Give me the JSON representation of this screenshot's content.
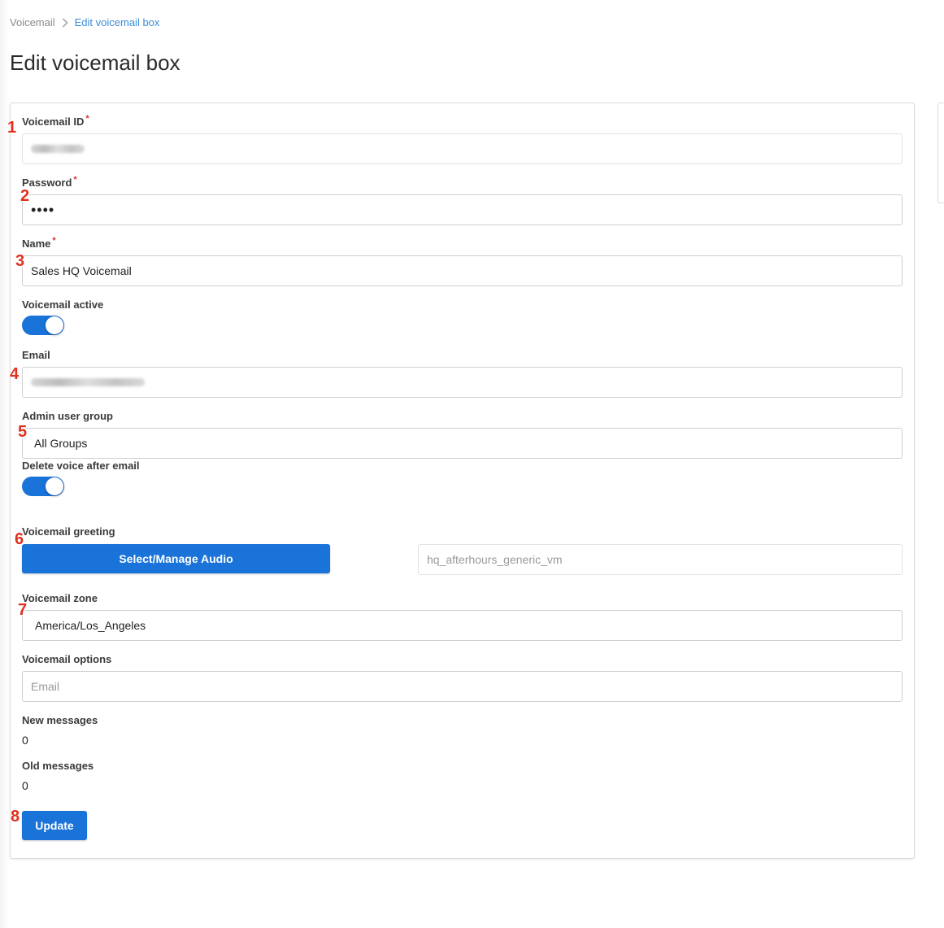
{
  "breadcrumb": {
    "root": "Voicemail",
    "current": "Edit voicemail box"
  },
  "page_title": "Edit voicemail box",
  "fields": {
    "voicemail_id": {
      "label": "Voicemail ID",
      "required_mark": "*"
    },
    "password": {
      "label": "Password",
      "required_mark": "*",
      "value": "••••"
    },
    "name": {
      "label": "Name",
      "required_mark": "*",
      "value": "Sales HQ Voicemail"
    },
    "voicemail_active": {
      "label": "Voicemail active",
      "on": true
    },
    "email": {
      "label": "Email"
    },
    "admin_user_group": {
      "label": "Admin user group",
      "value": "All Groups"
    },
    "delete_voice_after_email": {
      "label": "Delete voice after email",
      "on": true
    },
    "voicemail_greeting": {
      "label": "Voicemail greeting",
      "button_label": "Select/Manage Audio",
      "value": "hq_afterhours_generic_vm"
    },
    "voicemail_zone": {
      "label": "Voicemail zone",
      "value": "America/Los_Angeles"
    },
    "voicemail_options": {
      "label": "Voicemail options",
      "placeholder": "Email"
    },
    "new_messages": {
      "label": "New messages",
      "value": "0"
    },
    "old_messages": {
      "label": "Old messages",
      "value": "0"
    }
  },
  "update_button_label": "Update",
  "markers": [
    "1",
    "2",
    "3",
    "4",
    "5",
    "6",
    "7",
    "8"
  ],
  "colors": {
    "accent": "#1a73d9",
    "required": "#d9352b",
    "marker": "#e0301e",
    "link": "#3c8dd9"
  }
}
